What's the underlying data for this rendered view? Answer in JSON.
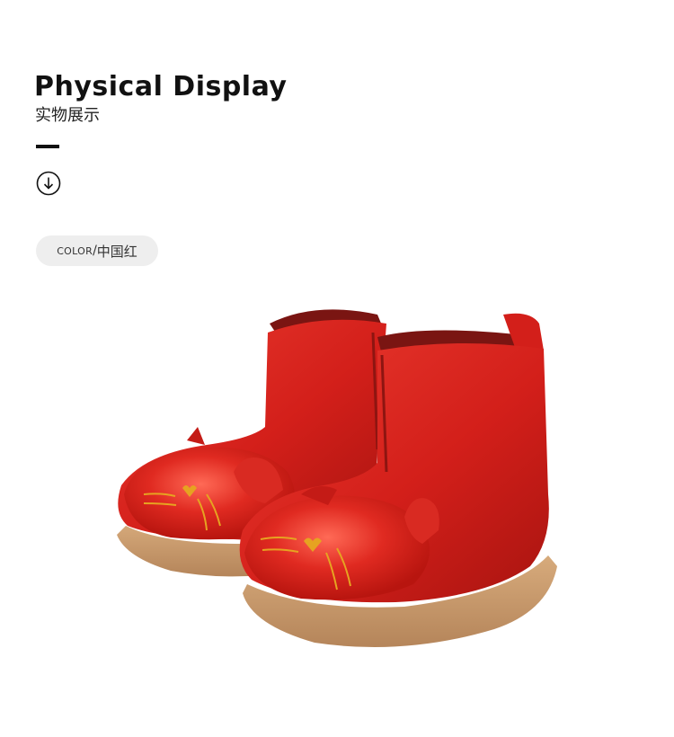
{
  "header": {
    "title": "Physical Display",
    "subtitle": "实物展示"
  },
  "icons": {
    "scroll_down": "arrow-down-circle-icon"
  },
  "color_tag": {
    "key": "COLOR",
    "separator": "/",
    "value": "中国红"
  },
  "product_image": {
    "subject": "red-cat-ankle-boots"
  },
  "colors": {
    "boot_red": "#d8201c",
    "sole_tan": "#c99a6a",
    "accent_gold": "#e6a321",
    "pill_bg": "#eeeeee",
    "text_dark": "#111111"
  }
}
